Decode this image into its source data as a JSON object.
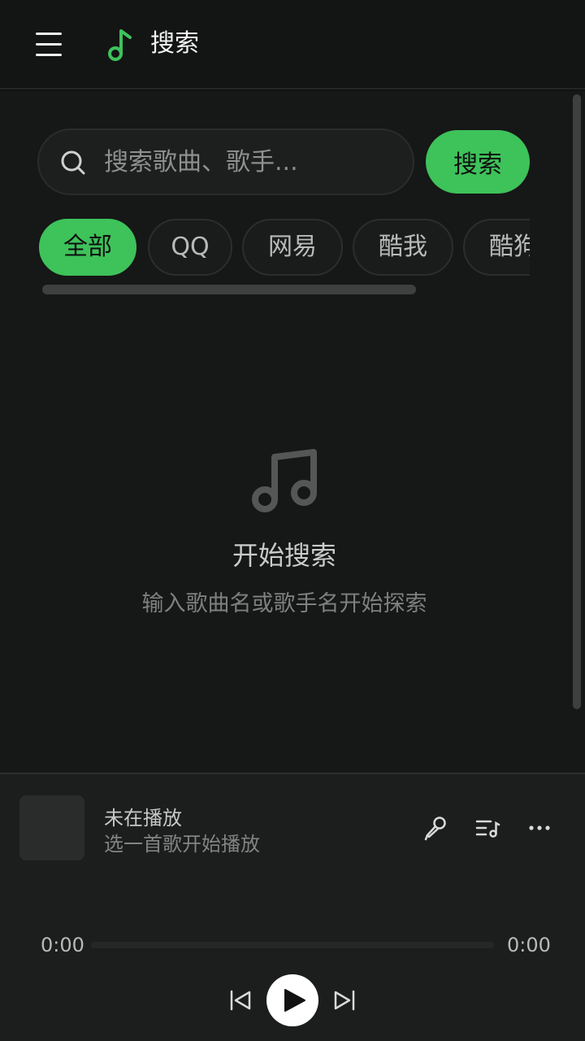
{
  "header": {
    "title": "搜索",
    "menu_icon": "hamburger-menu-icon",
    "logo_icon": "music-note-icon",
    "accent": "#3ec25a"
  },
  "search": {
    "placeholder": "搜索歌曲、歌手...",
    "value": "",
    "button_label": "搜索",
    "icon": "search-icon"
  },
  "tabs": [
    {
      "label": "全部",
      "active": true
    },
    {
      "label": "QQ",
      "active": false
    },
    {
      "label": "网易",
      "active": false
    },
    {
      "label": "酷我",
      "active": false
    },
    {
      "label": "酷狗",
      "active": false
    }
  ],
  "empty_state": {
    "icon": "music-notes-icon",
    "title": "开始搜索",
    "description": "输入歌曲名或歌手名开始探索"
  },
  "player": {
    "title": "未在播放",
    "subtitle": "选一首歌开始播放",
    "current_time": "0:00",
    "total_time": "0:00",
    "progress": 0,
    "icons": [
      "microphone-icon",
      "playlist-icon",
      "more-icon",
      "previous-icon",
      "play-icon",
      "next-icon"
    ]
  }
}
